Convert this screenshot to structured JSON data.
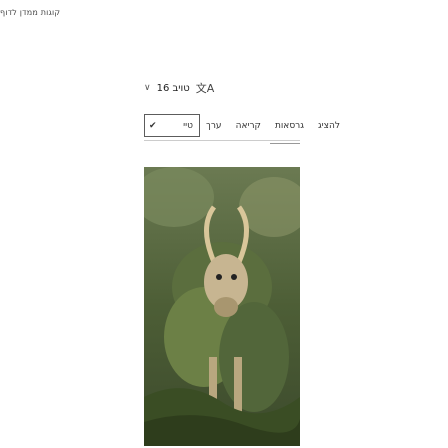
{
  "header": {
    "breadcrumb_text": "קוגות ממדן לדוף"
  },
  "language": {
    "label": "טויב 16",
    "chevron_icon": "chevron-down-icon",
    "translate_icon": "translate-icon",
    "translate_glyph": "文A",
    "chevron_glyph": "∨"
  },
  "tabs": {
    "checkbox_label": "טיי",
    "checkbox_glyph": "✔",
    "items": [
      "ערך",
      "קריאה",
      "גרסאות",
      "להציג"
    ]
  },
  "image": {
    "alt": "Photo"
  }
}
